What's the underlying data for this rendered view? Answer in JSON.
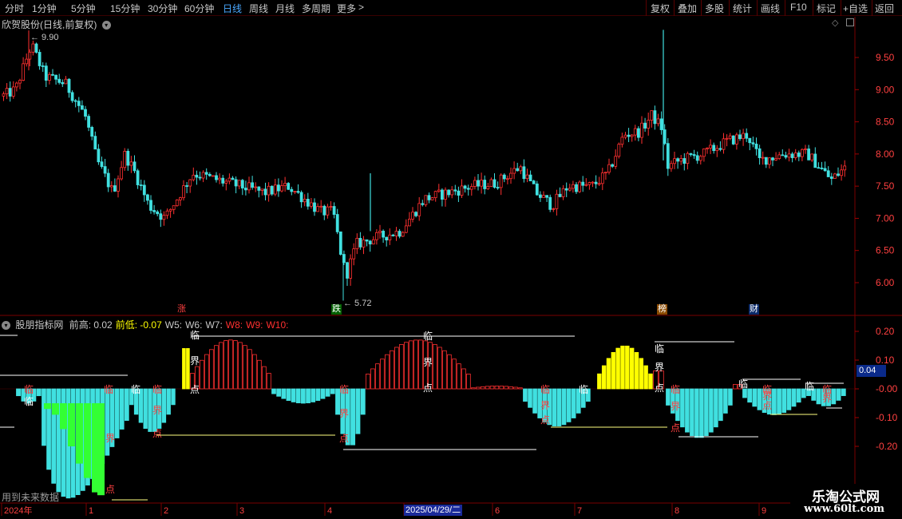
{
  "toolbar": {
    "left": [
      "分时",
      "1分钟",
      "5分钟",
      "15分钟",
      "30分钟",
      "60分钟",
      "日线",
      "周线",
      "月线",
      "多周期",
      "更多"
    ],
    "active": "日线",
    "right": [
      "复权",
      "叠加",
      "多股",
      "统计",
      "画线",
      "F10",
      "标记",
      "+自选",
      "返回"
    ]
  },
  "main_title": "欣贺股份(日线,前复权)",
  "indicator": {
    "name": "股朋指标网",
    "items": [
      {
        "label": "前高:",
        "value": "0.02",
        "color": "#c8c8c8"
      },
      {
        "label": "前低:",
        "value": "-0.07",
        "color": "#ffff00"
      },
      {
        "label": "W5:",
        "value": "",
        "color": "#c8c8c8"
      },
      {
        "label": "W6:",
        "value": "",
        "color": "#c8c8c8"
      },
      {
        "label": "W7:",
        "value": "",
        "color": "#c8c8c8"
      },
      {
        "label": "W8:",
        "value": "",
        "color": "#ff3030"
      },
      {
        "label": "W9:",
        "value": "",
        "color": "#ff3030"
      },
      {
        "label": "W10:",
        "value": "",
        "color": "#ff3030"
      }
    ],
    "current_value": "0.04"
  },
  "price_axis": [
    "9.50",
    "9.00",
    "8.50",
    "8.00",
    "7.50",
    "7.00",
    "6.50",
    "6.00"
  ],
  "ind_axis": [
    "0.20",
    "0.10",
    "-0.00",
    "-0.10",
    "-0.20"
  ],
  "annotations": {
    "high": "9.90",
    "low": "5.72"
  },
  "event_tags": [
    {
      "text": "涨",
      "bg": "#000",
      "color": "#ff4040"
    },
    {
      "text": "跌",
      "bg": "#006000",
      "color": "#ffffff"
    },
    {
      "text": "榜",
      "bg": "#8a4a00",
      "color": "#ffffff"
    },
    {
      "text": "财",
      "bg": "#0a2a6a",
      "color": "#ffffff"
    }
  ],
  "signal_chars": {
    "a": "临",
    "b": "界",
    "c": "点"
  },
  "date_axis": [
    "2024年",
    "1",
    "2",
    "3",
    "4",
    "2025/04/29/二",
    "6",
    "7",
    "8",
    "9"
  ],
  "bottom_note": "用到未来数据",
  "watermark": {
    "line1": "乐淘公式网",
    "line2": "www.60lt.com"
  },
  "colors": {
    "up": "#ff3030",
    "down": "#40e0e0",
    "active": "#4aa8ff",
    "yellow": "#ffff00",
    "green": "#33ff33"
  }
}
